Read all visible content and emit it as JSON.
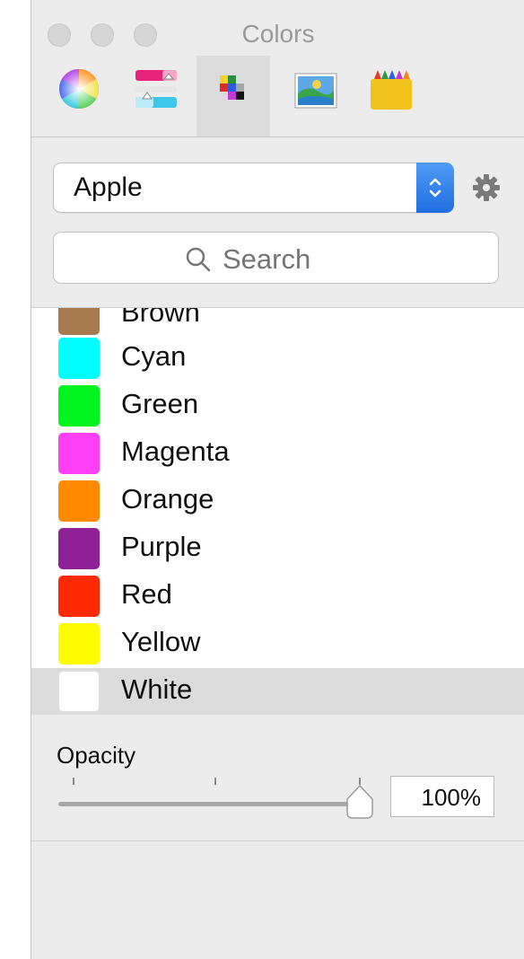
{
  "window": {
    "title": "Colors"
  },
  "toolbar": {
    "tabs": [
      {
        "name": "color-wheel",
        "icon": "color-wheel-icon"
      },
      {
        "name": "color-sliders",
        "icon": "color-sliders-icon"
      },
      {
        "name": "color-palettes",
        "icon": "color-palettes-icon",
        "selected": true
      },
      {
        "name": "image-palettes",
        "icon": "image-palettes-icon"
      },
      {
        "name": "pencils",
        "icon": "crayons-icon"
      }
    ]
  },
  "palette": {
    "selected": "Apple",
    "action_icon": "gear-icon"
  },
  "search": {
    "placeholder": "Search"
  },
  "colors": [
    {
      "label": "Brown",
      "color": "#a87a4f"
    },
    {
      "label": "Cyan",
      "color": "#00ffff"
    },
    {
      "label": "Green",
      "color": "#00f51e"
    },
    {
      "label": "Magenta",
      "color": "#ff3ff7"
    },
    {
      "label": "Orange",
      "color": "#ff8a00"
    },
    {
      "label": "Purple",
      "color": "#8f2196"
    },
    {
      "label": "Red",
      "color": "#ff2a00"
    },
    {
      "label": "Yellow",
      "color": "#fffb00"
    },
    {
      "label": "White",
      "color": "#ffffff",
      "selected": true
    }
  ],
  "opacity": {
    "label": "Opacity",
    "value_text": "100%",
    "value": 1.0
  }
}
